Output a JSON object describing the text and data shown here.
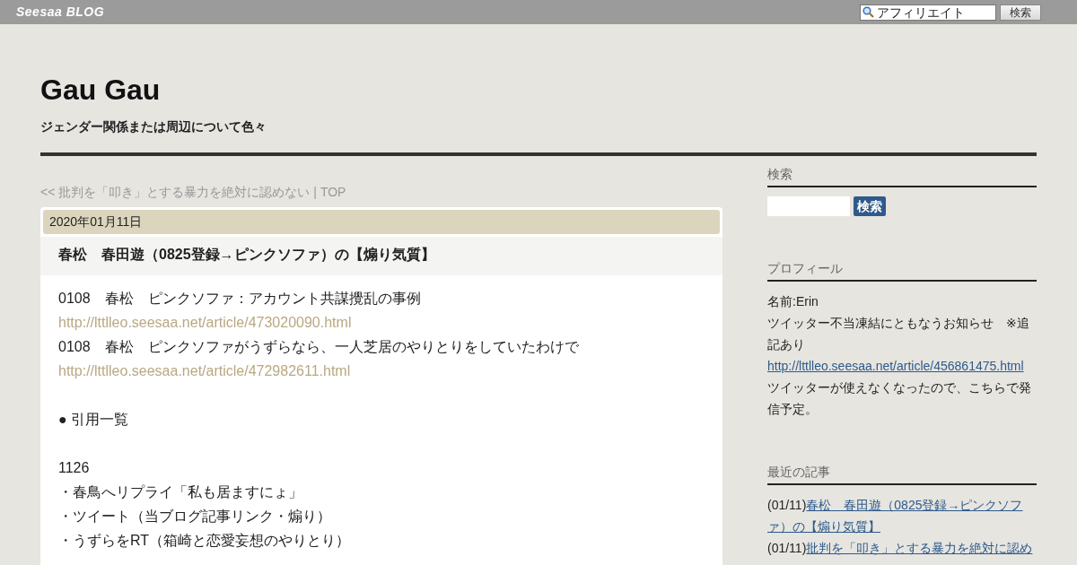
{
  "topbar": {
    "logo": "Seesaa BLOG",
    "search_value": "アフィリエイト",
    "search_button": "検索"
  },
  "blog": {
    "title": "Gau Gau",
    "subtitle": "ジェンダー関係または周辺について色々"
  },
  "article_nav": {
    "prev": "<< 批判を「叩き」とする暴力を絶対に認めない",
    "separator": "|",
    "top": "TOP"
  },
  "article": {
    "date": "2020年01月11日",
    "title": "春松　春田遊（0825登録→ピンクソファ）の【煽り気質】",
    "lines": [
      {
        "kind": "text",
        "text": "0108　春松　ピンクソファ：アカウント共謀攪乱の事例"
      },
      {
        "kind": "link",
        "text": "http://lttlleo.seesaa.net/article/473020090.html"
      },
      {
        "kind": "text",
        "text": "0108　春松　ピンクソファがうずらなら、一人芝居のやりとりをしていたわけで"
      },
      {
        "kind": "link",
        "text": "http://lttlleo.seesaa.net/article/472982611.html"
      },
      {
        "kind": "blank"
      },
      {
        "kind": "text",
        "text": "● 引用一覧"
      },
      {
        "kind": "blank"
      },
      {
        "kind": "text",
        "text": "1126"
      },
      {
        "kind": "text",
        "text": "・春鳥へリプライ「私も居ますにょ」"
      },
      {
        "kind": "text",
        "text": "・ツイート（当ブログ記事リンク・煽り）"
      },
      {
        "kind": "text",
        "text": "・うずらをRT（箱崎と恋愛妄想のやりとり）"
      }
    ]
  },
  "sidebar": {
    "search": {
      "heading": "検索",
      "button": "検索"
    },
    "profile": {
      "heading": "プロフィール",
      "name": "名前:Erin",
      "notice": "ツイッター不当凍結にともなうお知らせ　※追記あり",
      "link": "http://lttlleo.seesaa.net/article/456861475.html",
      "note": "ツイッターが使えなくなったので、こちらで発信予定。"
    },
    "recent": {
      "heading": "最近の記事",
      "items": [
        {
          "date": "(01/11)",
          "title": "春松　春田遊（0825登録→ピンクソファ）の【煽り気質】"
        },
        {
          "date": "(01/11)",
          "title": "批判を「叩き」とする暴力を絶対に認め"
        }
      ]
    }
  }
}
